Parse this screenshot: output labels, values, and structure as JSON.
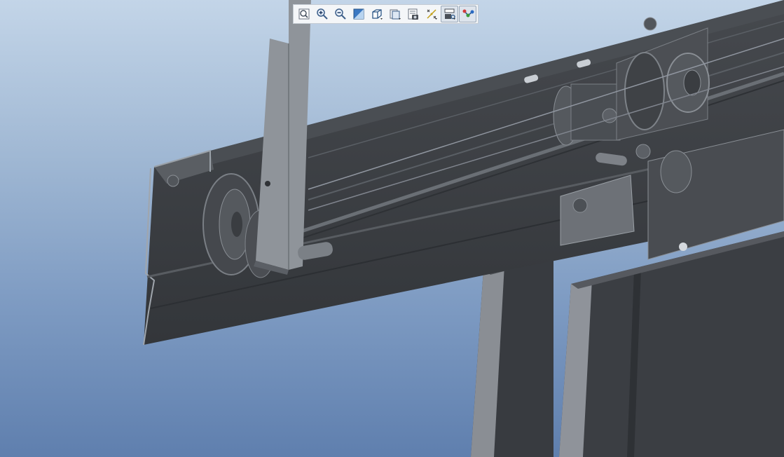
{
  "viewport": {
    "background_top": "#c3d5e8",
    "background_bottom": "#5f7fae"
  },
  "model_colors": {
    "rail": "#3c4045",
    "rail_highlight": "#9aa1a8",
    "bracket": "#8f949a",
    "door_panel": "#3a3d42",
    "door_edge": "#8c9096",
    "pulley": "#4a4d52"
  },
  "toolbar": {
    "items": [
      {
        "name": "refit-icon",
        "active": false
      },
      {
        "name": "zoom-in-icon",
        "active": false
      },
      {
        "name": "zoom-out-icon",
        "active": false
      },
      {
        "name": "repaint-icon",
        "active": false
      },
      {
        "name": "display-style-icon",
        "active": false
      },
      {
        "name": "saved-views-icon",
        "active": false
      },
      {
        "name": "view-manager-icon",
        "active": false
      },
      {
        "name": "datum-display-icon",
        "active": false
      },
      {
        "name": "annotation-display-icon",
        "active": true
      },
      {
        "name": "spin-center-icon",
        "active": true
      }
    ]
  }
}
